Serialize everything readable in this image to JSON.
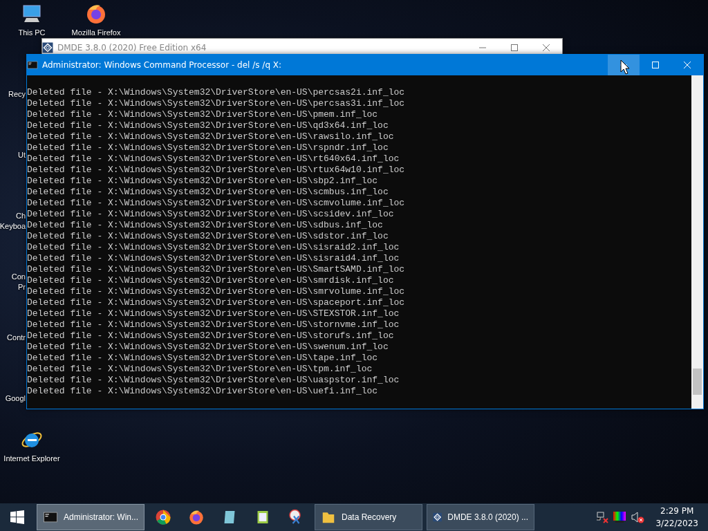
{
  "desktop_icons": [
    {
      "kind": "pc",
      "lines": [
        "This PC"
      ]
    },
    {
      "kind": "recycle",
      "lines": [
        "Recy"
      ]
    },
    {
      "kind": "folder",
      "lines": [
        "Ut"
      ]
    },
    {
      "kind": "keyboard",
      "lines": [
        "Ch",
        "Keyboa"
      ]
    },
    {
      "kind": "cmd",
      "lines": [
        "Con",
        "Pr"
      ]
    },
    {
      "kind": "control",
      "lines": [
        "Contr"
      ]
    },
    {
      "kind": "chrome",
      "lines": [
        "Googl"
      ]
    },
    {
      "kind": "ie",
      "lines": [
        "Internet Explorer"
      ]
    },
    {
      "kind": "firefox",
      "lines": [
        "Mozilla Firefox"
      ]
    }
  ],
  "back_window": {
    "title": "DMDE 3.8.0 (2020) Free Edition x64"
  },
  "console_window": {
    "title": "Administrator: Windows Command Processor - del  /s /q X:",
    "title_buttons": [
      {
        "kind": "minimize",
        "hovered": true
      },
      {
        "kind": "maximize",
        "hovered": false
      },
      {
        "kind": "close",
        "hovered": false
      }
    ],
    "lines": [
      "Deleted file - X:\\Windows\\System32\\DriverStore\\en-US\\percsas2i.inf_loc",
      "Deleted file - X:\\Windows\\System32\\DriverStore\\en-US\\percsas3i.inf_loc",
      "Deleted file - X:\\Windows\\System32\\DriverStore\\en-US\\pmem.inf_loc",
      "Deleted file - X:\\Windows\\System32\\DriverStore\\en-US\\qd3x64.inf_loc",
      "Deleted file - X:\\Windows\\System32\\DriverStore\\en-US\\rawsilo.inf_loc",
      "Deleted file - X:\\Windows\\System32\\DriverStore\\en-US\\rspndr.inf_loc",
      "Deleted file - X:\\Windows\\System32\\DriverStore\\en-US\\rt640x64.inf_loc",
      "Deleted file - X:\\Windows\\System32\\DriverStore\\en-US\\rtux64w10.inf_loc",
      "Deleted file - X:\\Windows\\System32\\DriverStore\\en-US\\sbp2.inf_loc",
      "Deleted file - X:\\Windows\\System32\\DriverStore\\en-US\\scmbus.inf_loc",
      "Deleted file - X:\\Windows\\System32\\DriverStore\\en-US\\scmvolume.inf_loc",
      "Deleted file - X:\\Windows\\System32\\DriverStore\\en-US\\scsidev.inf_loc",
      "Deleted file - X:\\Windows\\System32\\DriverStore\\en-US\\sdbus.inf_loc",
      "Deleted file - X:\\Windows\\System32\\DriverStore\\en-US\\sdstor.inf_loc",
      "Deleted file - X:\\Windows\\System32\\DriverStore\\en-US\\sisraid2.inf_loc",
      "Deleted file - X:\\Windows\\System32\\DriverStore\\en-US\\sisraid4.inf_loc",
      "Deleted file - X:\\Windows\\System32\\DriverStore\\en-US\\SmartSAMD.inf_loc",
      "Deleted file - X:\\Windows\\System32\\DriverStore\\en-US\\smrdisk.inf_loc",
      "Deleted file - X:\\Windows\\System32\\DriverStore\\en-US\\smrvolume.inf_loc",
      "Deleted file - X:\\Windows\\System32\\DriverStore\\en-US\\spaceport.inf_loc",
      "Deleted file - X:\\Windows\\System32\\DriverStore\\en-US\\STEXSTOR.inf_loc",
      "Deleted file - X:\\Windows\\System32\\DriverStore\\en-US\\stornvme.inf_loc",
      "Deleted file - X:\\Windows\\System32\\DriverStore\\en-US\\storufs.inf_loc",
      "Deleted file - X:\\Windows\\System32\\DriverStore\\en-US\\swenum.inf_loc",
      "Deleted file - X:\\Windows\\System32\\DriverStore\\en-US\\tape.inf_loc",
      "Deleted file - X:\\Windows\\System32\\DriverStore\\en-US\\tpm.inf_loc",
      "Deleted file - X:\\Windows\\System32\\DriverStore\\en-US\\uaspstor.inf_loc",
      "Deleted file - X:\\Windows\\System32\\DriverStore\\en-US\\uefi.inf_loc"
    ]
  },
  "taskbar": {
    "items": [
      {
        "kind": "cmd",
        "label": "Administrator: Win...",
        "selected": true
      },
      {
        "kind": "chrome"
      },
      {
        "kind": "firefox"
      },
      {
        "kind": "notepad"
      },
      {
        "kind": "editor"
      },
      {
        "kind": "snipping"
      },
      {
        "kind": "folder",
        "label": "Data Recovery",
        "selected": false
      },
      {
        "kind": "dmde",
        "label": "DMDE 3.8.0 (2020) ...",
        "selected": false
      }
    ],
    "time": "2:29 PM",
    "date": "3/22/2023"
  }
}
